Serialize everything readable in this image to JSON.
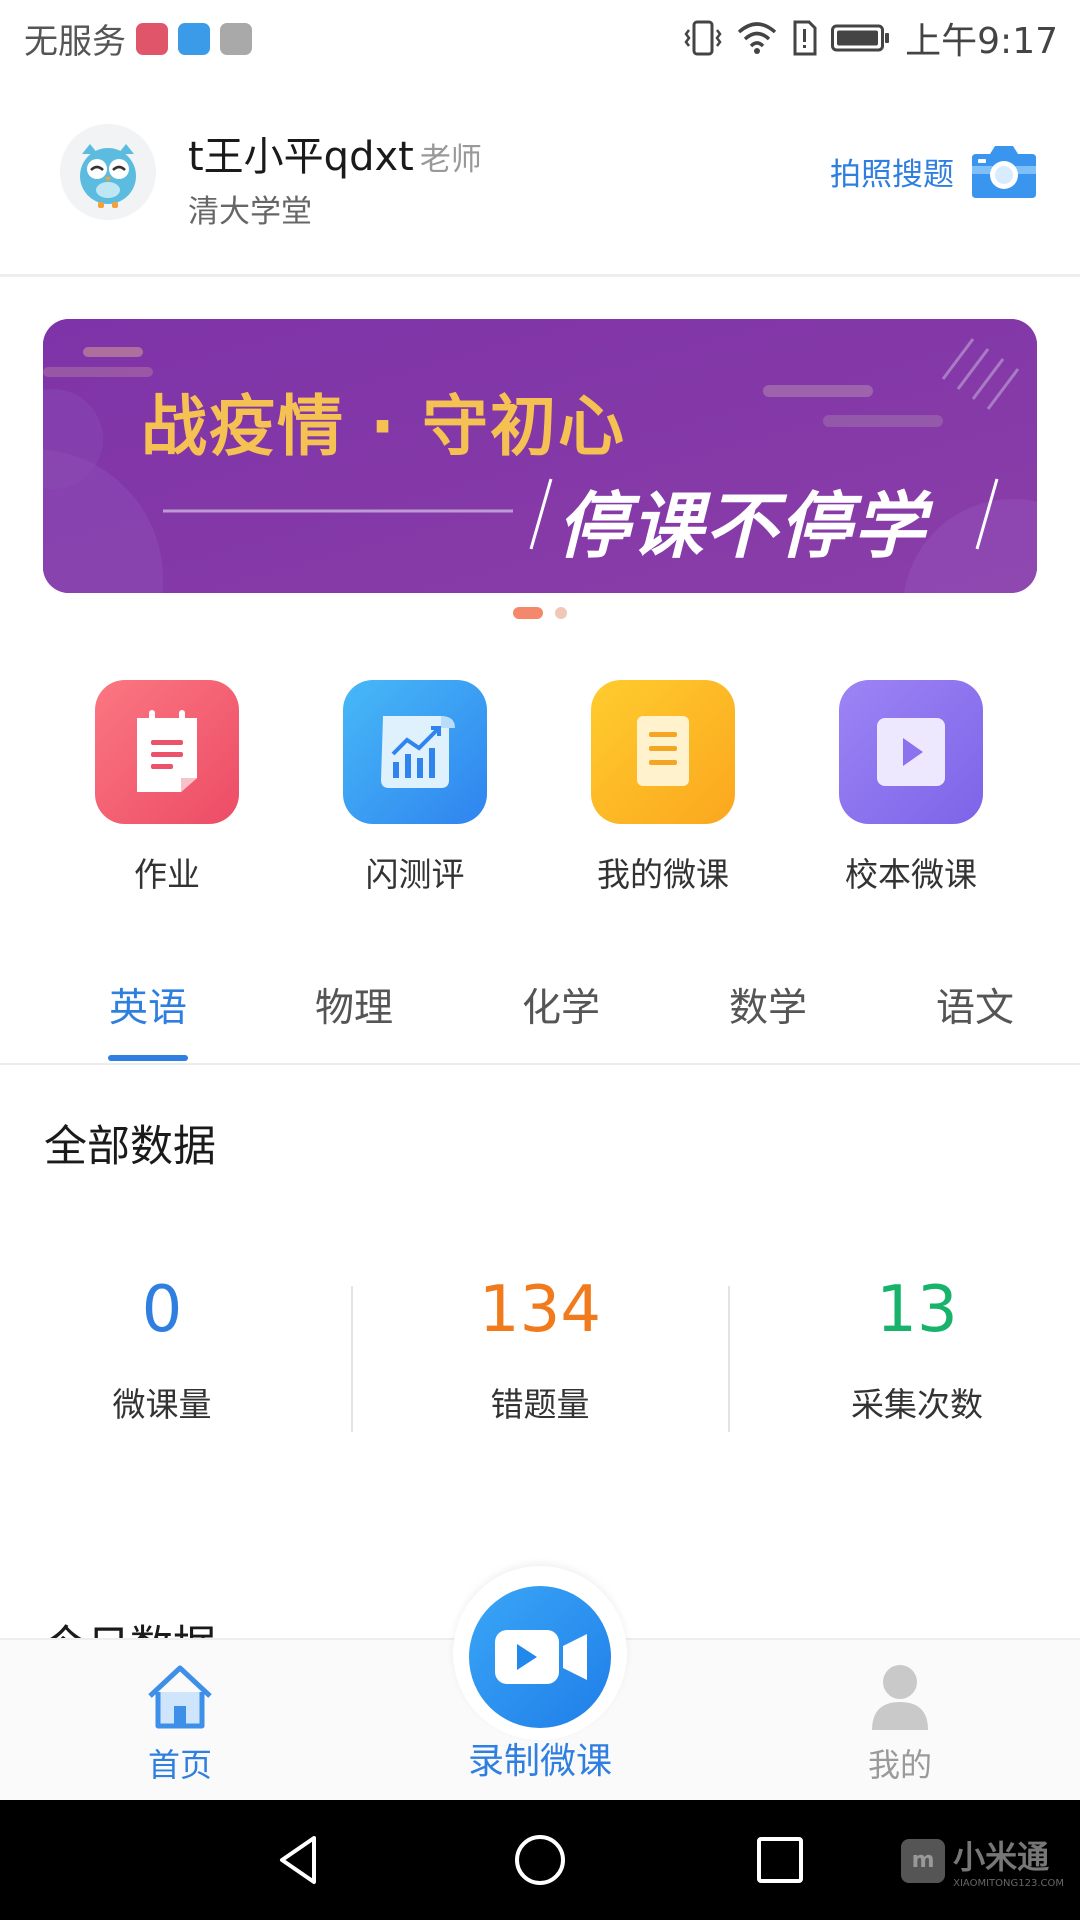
{
  "status_bar": {
    "carrier": "无服务",
    "time": "上午9:17",
    "app_icons": [
      "vmall-icon",
      "heart-app-icon",
      "chat-app-icon"
    ],
    "indicators": [
      "vibrate-icon",
      "wifi-icon",
      "sim-alert-icon",
      "battery-icon"
    ]
  },
  "header": {
    "user_name": "t王小平qdxt",
    "role": "老师",
    "school": "清大学堂",
    "photo_search_label": "拍照搜题",
    "avatar_icon": "owl-avatar-icon",
    "camera_icon": "camera-icon"
  },
  "banner": {
    "title_line1": "战疫情 · 守初心",
    "title_line2": "停课不停学",
    "pages": 2,
    "active_page": 1
  },
  "quick_entries": [
    {
      "label": "作业",
      "icon": "homework-icon",
      "color": "#f25f6e"
    },
    {
      "label": "闪测评",
      "icon": "quick-test-icon",
      "color": "#2f8ff0"
    },
    {
      "label": "我的微课",
      "icon": "my-microlesson-icon",
      "color": "#fdb425"
    },
    {
      "label": "校本微课",
      "icon": "school-microlesson-icon",
      "color": "#8b72ee"
    }
  ],
  "subject_tabs": [
    {
      "label": "英语",
      "active": true
    },
    {
      "label": "物理",
      "active": false
    },
    {
      "label": "化学",
      "active": false
    },
    {
      "label": "数学",
      "active": false
    },
    {
      "label": "语文",
      "active": false
    }
  ],
  "all_data": {
    "title": "全部数据",
    "stats": [
      {
        "value": "0",
        "label": "微课量",
        "color": "#2f7fe0"
      },
      {
        "value": "134",
        "label": "错题量",
        "color": "#f07a1c"
      },
      {
        "value": "13",
        "label": "采集次数",
        "color": "#17b36b"
      }
    ]
  },
  "today_data": {
    "title": "今日数据"
  },
  "bottom_nav": {
    "home_label": "首页",
    "record_label": "录制微课",
    "mine_label": "我的",
    "home_icon": "home-icon",
    "record_icon": "video-camera-icon",
    "mine_icon": "person-icon"
  },
  "watermark": {
    "text": "小米通",
    "sub": "XIAOMITONG123.COM"
  },
  "colors": {
    "accent": "#2f7fe0",
    "banner_bg": "#7f3aa6",
    "banner_title": "#f4c152"
  }
}
